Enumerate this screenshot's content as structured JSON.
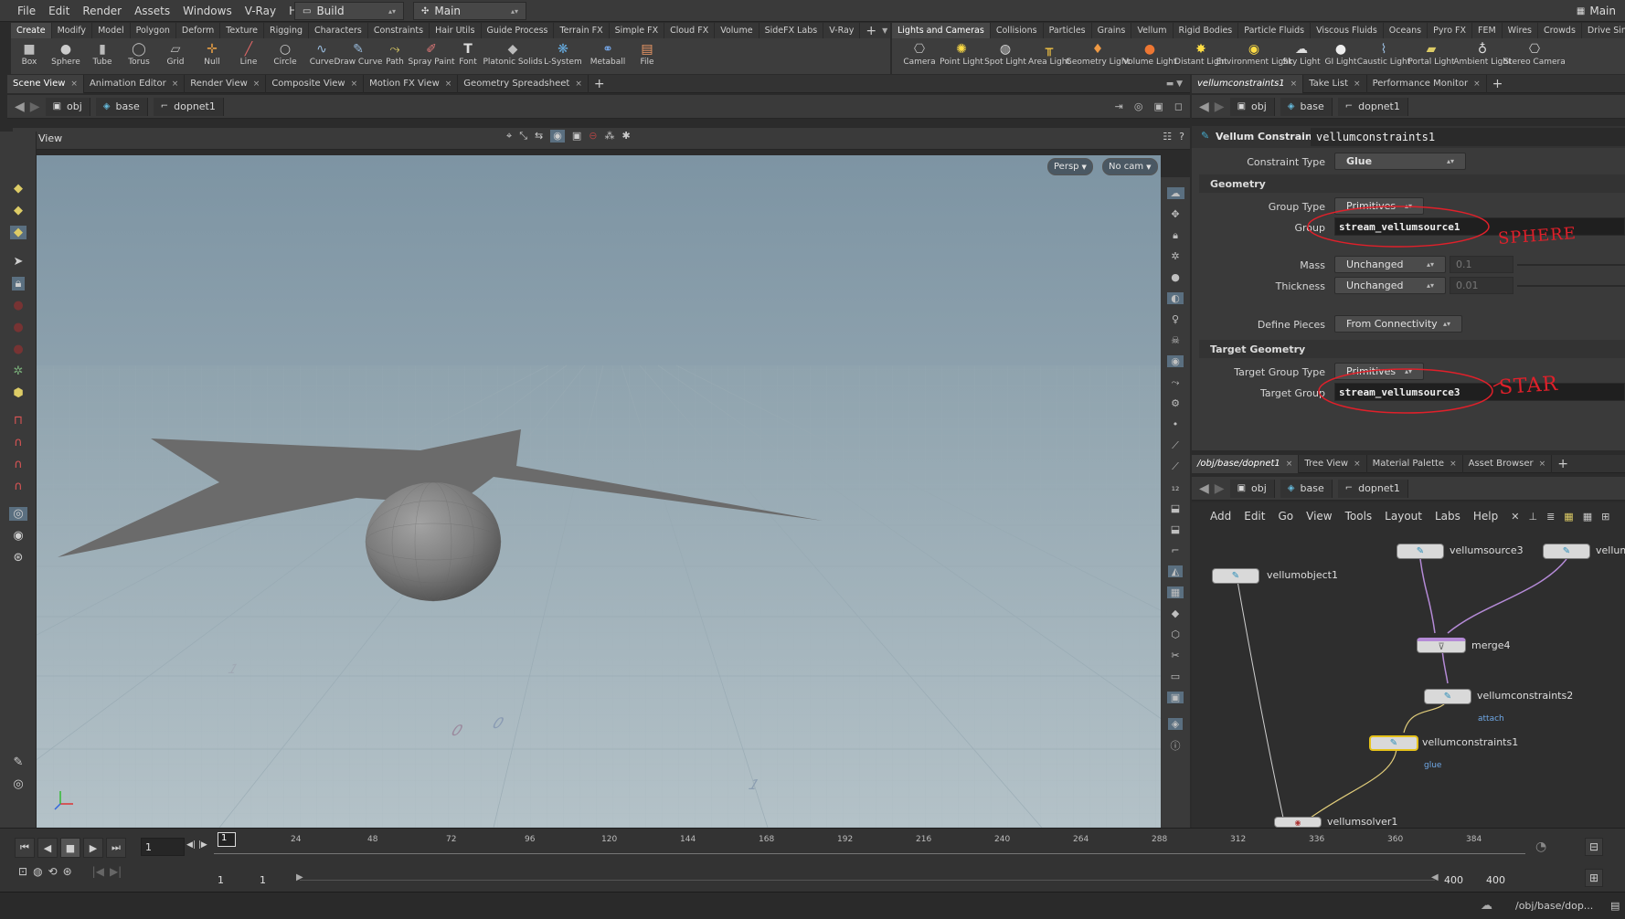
{
  "menubar": {
    "items": [
      "File",
      "Edit",
      "Render",
      "Assets",
      "Windows",
      "V-Ray",
      "Help"
    ],
    "desktop_label": "Build",
    "network_label": "Main",
    "right_label": "Main"
  },
  "shelf_left": {
    "tabs": [
      "Create",
      "Modify",
      "Model",
      "Polygon",
      "Deform",
      "Texture",
      "Rigging",
      "Characters",
      "Constraints",
      "Hair Utils",
      "Guide Process",
      "Terrain FX",
      "Simple FX",
      "Cloud FX",
      "Volume",
      "SideFX Labs",
      "V-Ray"
    ],
    "tools": [
      {
        "label": "Box",
        "icon": "box-icon"
      },
      {
        "label": "Sphere",
        "icon": "sphere-icon"
      },
      {
        "label": "Tube",
        "icon": "tube-icon"
      },
      {
        "label": "Torus",
        "icon": "torus-icon"
      },
      {
        "label": "Grid",
        "icon": "grid-icon"
      },
      {
        "label": "Null",
        "icon": "null-icon"
      },
      {
        "label": "Line",
        "icon": "line-icon"
      },
      {
        "label": "Circle",
        "icon": "circle-icon"
      },
      {
        "label": "Curve",
        "icon": "curve-icon"
      },
      {
        "label": "Draw Curve",
        "icon": "draw-curve-icon"
      },
      {
        "label": "Path",
        "icon": "path-icon"
      },
      {
        "label": "Spray Paint",
        "icon": "spray-paint-icon"
      },
      {
        "label": "Font",
        "icon": "font-icon"
      },
      {
        "label": "Platonic Solids",
        "icon": "platonic-solids-icon"
      },
      {
        "label": "L-System",
        "icon": "l-system-icon"
      },
      {
        "label": "Metaball",
        "icon": "metaball-icon"
      },
      {
        "label": "File",
        "icon": "file-icon"
      }
    ]
  },
  "shelf_right": {
    "tabs": [
      "Lights and Cameras",
      "Collisions",
      "Particles",
      "Grains",
      "Vellum",
      "Rigid Bodies",
      "Particle Fluids",
      "Viscous Fluids",
      "Oceans",
      "Pyro FX",
      "FEM",
      "Wires",
      "Crowds",
      "Drive Simulation"
    ],
    "tools": [
      {
        "label": "Camera",
        "icon": "camera-icon"
      },
      {
        "label": "Point Light",
        "icon": "point-light-icon"
      },
      {
        "label": "Spot Light",
        "icon": "spot-light-icon"
      },
      {
        "label": "Area Light",
        "icon": "area-light-icon"
      },
      {
        "label": "Geometry Light",
        "icon": "geometry-light-icon"
      },
      {
        "label": "Volume Light",
        "icon": "volume-light-icon"
      },
      {
        "label": "Distant Light",
        "icon": "distant-light-icon"
      },
      {
        "label": "Environment Light",
        "icon": "environment-light-icon"
      },
      {
        "label": "Sky Light",
        "icon": "sky-light-icon"
      },
      {
        "label": "GI Light",
        "icon": "gi-light-icon"
      },
      {
        "label": "Caustic Light",
        "icon": "caustic-light-icon"
      },
      {
        "label": "Portal Light",
        "icon": "portal-light-icon"
      },
      {
        "label": "Ambient Light",
        "icon": "ambient-light-icon"
      },
      {
        "label": "Stereo Camera",
        "icon": "stereo-camera-icon"
      }
    ]
  },
  "viewer": {
    "tabs": [
      "Scene View",
      "Animation Editor",
      "Render View",
      "Composite View",
      "Motion FX View",
      "Geometry Spreadsheet"
    ],
    "path": [
      "obj",
      "base",
      "dopnet1"
    ],
    "title": "View",
    "persp_label": "Persp",
    "cam_label": "No cam",
    "floor_numbers": [
      "1",
      "0",
      "0",
      "1"
    ]
  },
  "params": {
    "tabs": [
      "vellumconstraints1",
      "Take List",
      "Performance Monitor"
    ],
    "path": [
      "obj",
      "base",
      "dopnet1"
    ],
    "node_type": "Vellum Constraints",
    "node_name": "vellumconstraints1",
    "constraint_type_label": "Constraint Type",
    "constraint_type": "Glue",
    "section_geometry": "Geometry",
    "group_type_label": "Group Type",
    "group_type": "Primitives",
    "group_label": "Group",
    "group": "stream_vellumsource1",
    "mass_label": "Mass",
    "mass": "Unchanged",
    "mass_value": "0.1",
    "thickness_label": "Thickness",
    "thickness": "Unchanged",
    "thickness_value": "0.01",
    "define_pieces_label": "Define Pieces",
    "define_pieces": "From Connectivity",
    "section_target": "Target Geometry",
    "target_group_type_label": "Target Group Type",
    "target_group_type": "Primitives",
    "target_group_label": "Target Group",
    "target_group": "stream_vellumsource3",
    "annotation_sphere": "SPHERE",
    "annotation_star": "STAR"
  },
  "network": {
    "tabs": [
      "/obj/base/dopnet1",
      "Tree View",
      "Material Palette",
      "Asset Browser"
    ],
    "path": [
      "obj",
      "base",
      "dopnet1"
    ],
    "menu": [
      "Add",
      "Edit",
      "Go",
      "View",
      "Tools",
      "Layout",
      "Labs",
      "Help"
    ],
    "nodes": {
      "vellumobject1": "vellumobject1",
      "vellumsource3": "vellumsource3",
      "vellumsource_cut": "vellum",
      "merge4": "merge4",
      "vellumconstraints2": "vellumconstraints2",
      "vellumconstraints2_sub": "attach",
      "vellumconstraints1": "vellumconstraints1",
      "vellumconstraints1_sub": "glue",
      "vellumsolver1": "vellumsolver1"
    }
  },
  "timeline": {
    "frame": "1",
    "ticks": [
      "24",
      "48",
      "72",
      "96",
      "120",
      "144",
      "168",
      "192",
      "216",
      "240",
      "264",
      "288",
      "312",
      "336",
      "360",
      "384"
    ],
    "range_start": "1",
    "range_start2": "1",
    "range_end": "400",
    "range_end2": "400",
    "current_marker": "1"
  },
  "status": {
    "path": "/obj/base/dop..."
  },
  "colors": {
    "accent_selected": "#e6c21a",
    "annotation_red": "#e0202a",
    "sky_top": "#7d94a3",
    "floor": "#a9b8bf",
    "wire": "#b48ad6"
  }
}
